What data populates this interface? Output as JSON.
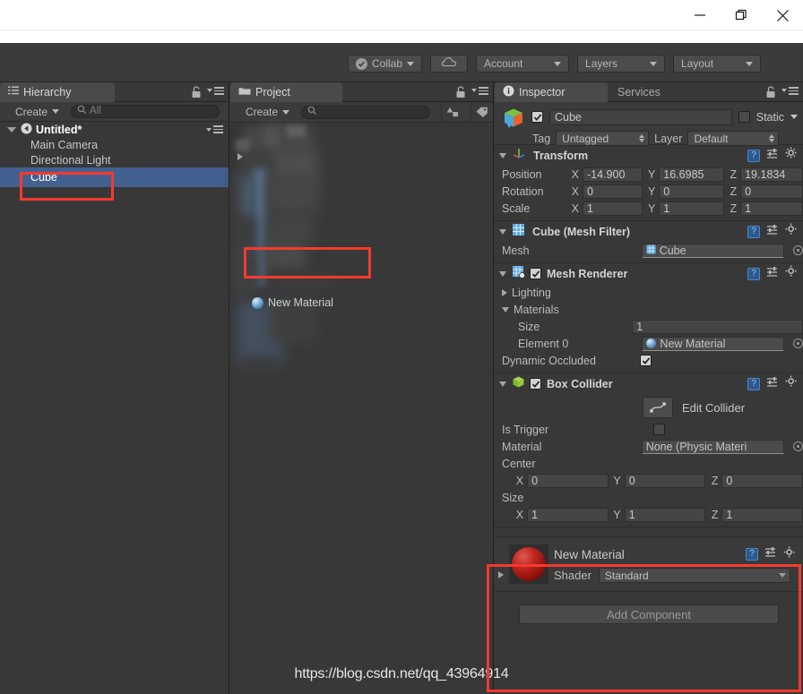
{
  "window": {
    "minimize_label": "minimize",
    "restore_label": "restore",
    "close_label": "close"
  },
  "toolbar": {
    "collab_label": "Collab",
    "cloud_label": "cloud-services",
    "account_label": "Account",
    "layers_label": "Layers",
    "layout_label": "Layout"
  },
  "hierarchy": {
    "tab_label": "Hierarchy",
    "create_label": "Create",
    "search_placeholder": "All",
    "scene_name": "Untitled*",
    "items": [
      {
        "label": "Main Camera",
        "selected": false
      },
      {
        "label": "Directional Light",
        "selected": false
      },
      {
        "label": "Cube",
        "selected": true
      }
    ]
  },
  "project": {
    "tab_label": "Project",
    "create_label": "Create",
    "search_placeholder": "",
    "material_item": "New Material",
    "censored_note": "blurred-assets"
  },
  "inspector": {
    "tab_label": "Inspector",
    "services_tab_label": "Services",
    "object_name": "Cube",
    "enabled": true,
    "static_label": "Static",
    "static_checked": false,
    "tag_label": "Tag",
    "tag_value": "Untagged",
    "layer_label": "Layer",
    "layer_value": "Default",
    "transform": {
      "title": "Transform",
      "rows": [
        {
          "label": "Position",
          "x": "-14.900",
          "y": "16.6985",
          "z": "19.1834"
        },
        {
          "label": "Rotation",
          "x": "0",
          "y": "0",
          "z": "0"
        },
        {
          "label": "Scale",
          "x": "1",
          "y": "1",
          "z": "1"
        }
      ]
    },
    "mesh_filter": {
      "title": "Cube (Mesh Filter)",
      "mesh_label": "Mesh",
      "mesh_value": "Cube"
    },
    "mesh_renderer": {
      "title": "Mesh Renderer",
      "enabled": true,
      "lighting_label": "Lighting",
      "materials_label": "Materials",
      "size_label": "Size",
      "size_value": "1",
      "element0_label": "Element 0",
      "element0_value": "New Material",
      "dynamic_occluded_label": "Dynamic Occluded",
      "dynamic_occluded_checked": true
    },
    "box_collider": {
      "title": "Box Collider",
      "enabled": true,
      "edit_collider_label": "Edit Collider",
      "is_trigger_label": "Is Trigger",
      "is_trigger_checked": false,
      "material_label": "Material",
      "material_value": "None (Physic Materi",
      "center_label": "Center",
      "center": {
        "x": "0",
        "y": "0",
        "z": "0"
      },
      "size_label": "Size",
      "size": {
        "x": "1",
        "y": "1",
        "z": "1"
      }
    },
    "material_asset": {
      "title": "New Material",
      "shader_label": "Shader",
      "shader_value": "Standard"
    },
    "add_component_label": "Add Component"
  },
  "watermark": "https://blog.csdn.net/qq_43964914",
  "colors": {
    "selection_blue": "#436190",
    "annotation_red": "#f53a2e",
    "panel_bg": "#383838",
    "toolbar_bg": "#3b3b3b"
  }
}
